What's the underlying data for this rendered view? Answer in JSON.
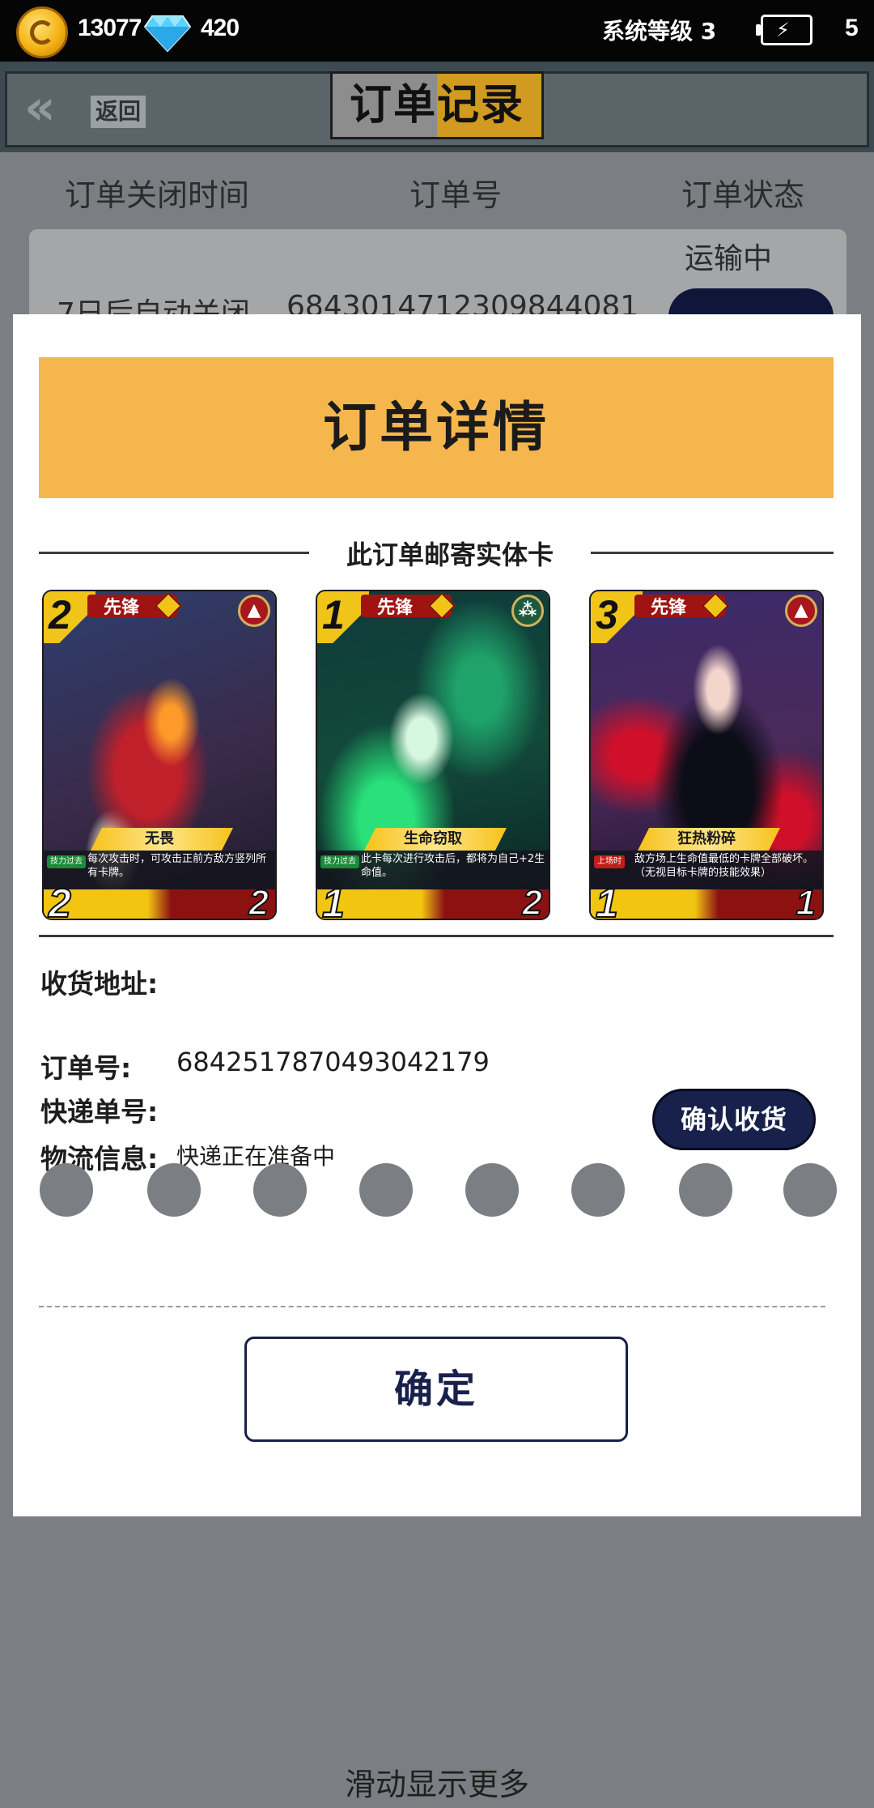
{
  "status_bar": {
    "coins": "13077",
    "gems": "420",
    "system_level": "系统等级 3",
    "battery_count": "5"
  },
  "header": {
    "back_label": "返回",
    "title": "订单记录"
  },
  "order_list": {
    "columns": [
      "订单关闭时间",
      "订单号",
      "订单状态"
    ],
    "rows": [
      {
        "close_time": "7日后自动关闭",
        "order_no": "6843014712309844081",
        "status": "运输中"
      }
    ]
  },
  "modal": {
    "title": "订单详情",
    "section_label": "此订单邮寄实体卡",
    "cards": [
      {
        "cost": "2",
        "role": "先锋",
        "name": "无畏",
        "tag": "技力过去",
        "text": "每次攻击时，可攻击正前方敌方竖列所有卡牌。",
        "attack": "2",
        "hp": "2",
        "faction_icon": "flame-icon"
      },
      {
        "cost": "1",
        "role": "先锋",
        "name": "生命窃取",
        "tag": "技力过去",
        "text": "此卡每次进行攻击后，都将为自己+2生命值。",
        "attack": "1",
        "hp": "2",
        "faction_icon": "triad-icon"
      },
      {
        "cost": "3",
        "role": "先锋",
        "name": "狂热粉碎",
        "tag": "上场时",
        "text": "敌方场上生命值最低的卡牌全部破坏。（无视目标卡牌的技能效果）",
        "attack": "1",
        "hp": "1",
        "faction_icon": "flame-icon"
      }
    ],
    "address_label": "收货地址:",
    "address_value": "",
    "order_no_label": "订单号:",
    "order_no_value": "6842517870493042179",
    "tracking_label": "快递单号:",
    "tracking_value": "",
    "logistics_label": "物流信息:",
    "logistics_value": "快递正在准备中",
    "confirm_receipt_label": "确认收货",
    "ok_label": "确定"
  },
  "scroll_hint": "滑动显示更多",
  "colors": {
    "accent_orange": "#f6b64e",
    "navy": "#18204c",
    "overlay_gray": "#7b7f83"
  }
}
